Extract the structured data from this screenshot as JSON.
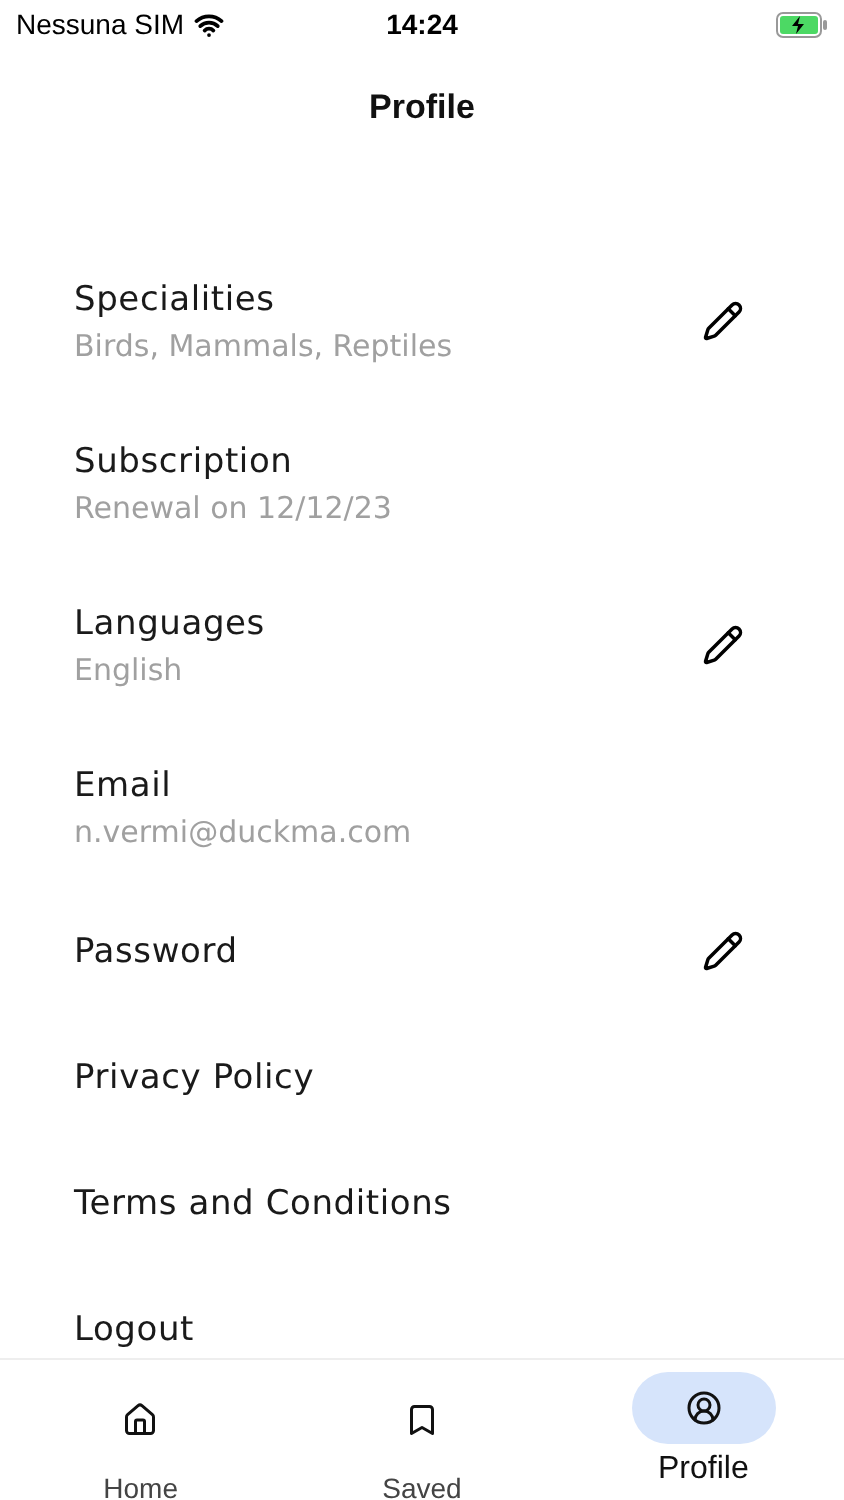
{
  "status_bar": {
    "carrier": "Nessuna SIM",
    "time": "14:24"
  },
  "header": {
    "title": "Profile"
  },
  "settings": [
    {
      "label": "Specialities",
      "value": "Birds, Mammals, Reptiles",
      "editable": true
    },
    {
      "label": "Subscription",
      "value": "Renewal on 12/12/23",
      "editable": false
    },
    {
      "label": "Languages",
      "value": "English",
      "editable": true
    },
    {
      "label": "Email",
      "value": "n.vermi@duckma.com",
      "editable": false
    },
    {
      "label": "Password",
      "editable": true
    },
    {
      "label": "Privacy Policy",
      "editable": false
    },
    {
      "label": "Terms and Conditions",
      "editable": false
    },
    {
      "label": "Logout",
      "editable": false
    }
  ],
  "tab_bar": [
    {
      "label": "Home",
      "kind": "home",
      "selected": false
    },
    {
      "label": "Saved",
      "kind": "saved",
      "selected": false
    },
    {
      "label": "Profile",
      "kind": "profile",
      "selected": true
    }
  ]
}
